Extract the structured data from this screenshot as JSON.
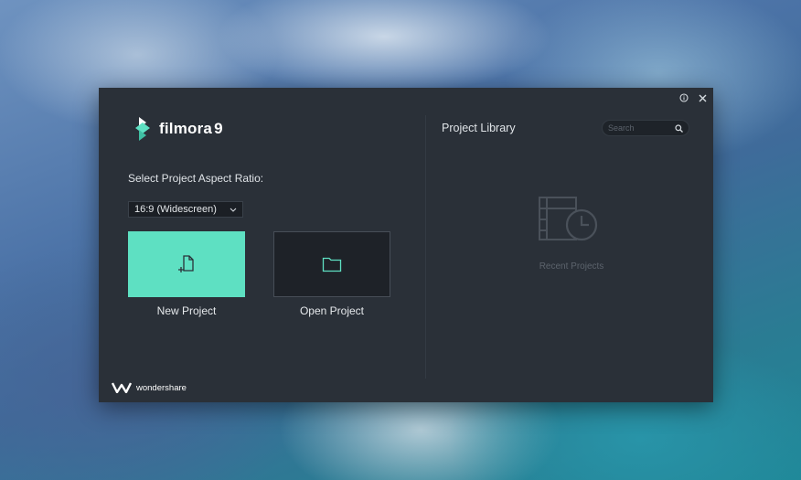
{
  "dialog": {
    "info_icon": "info-icon",
    "close_icon": "close-icon"
  },
  "app": {
    "logo_text": "filmora",
    "logo_version": "9"
  },
  "left": {
    "aspect_label": "Select Project Aspect Ratio:",
    "aspect_selected": "16:9 (Widescreen)",
    "new_project_label": "New Project",
    "open_project_label": "Open Project"
  },
  "library": {
    "title": "Project Library",
    "search_placeholder": "Search",
    "empty_text": "Recent Projects"
  },
  "footer": {
    "brand": "wondershare"
  },
  "colors": {
    "dialog_bg": "#2a3038",
    "accent": "#5ee0c2",
    "text": "#dfe3e7",
    "muted": "#5c636c"
  }
}
